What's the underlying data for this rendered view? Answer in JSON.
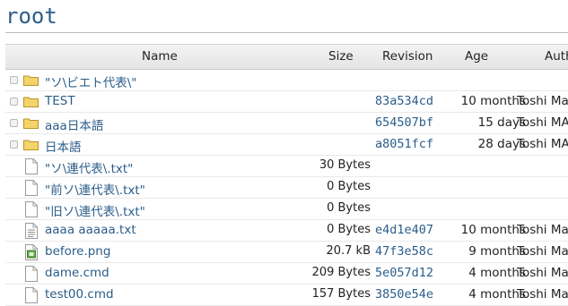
{
  "page": {
    "title": "root"
  },
  "columns": {
    "name": "Name",
    "size": "Size",
    "revision": "Revision",
    "age": "Age",
    "author": "Auth"
  },
  "rows": [
    {
      "type": "folder",
      "name": "\"ソ\\ビエト代表\\\"",
      "size": "",
      "revision": "",
      "age": "",
      "author": ""
    },
    {
      "type": "folder",
      "name": "TEST",
      "size": "",
      "revision": "83a534cd",
      "age": "10 months",
      "author": "Toshi Ma"
    },
    {
      "type": "folder",
      "name": "aaa日本語",
      "size": "",
      "revision": "654507bf",
      "age": "15 days",
      "author": "Toshi MA"
    },
    {
      "type": "folder",
      "name": "日本語",
      "size": "",
      "revision": "a8051fcf",
      "age": "28 days",
      "author": "Toshi MA"
    },
    {
      "type": "file",
      "name": "\"ソ\\連代表\\.txt\"",
      "size": "30 Bytes",
      "revision": "",
      "age": "",
      "author": ""
    },
    {
      "type": "file",
      "name": "\"前ソ\\連代表\\.txt\"",
      "size": "0 Bytes",
      "revision": "",
      "age": "",
      "author": ""
    },
    {
      "type": "file",
      "name": "\"旧ソ\\連代表\\.txt\"",
      "size": "0 Bytes",
      "revision": "",
      "age": "",
      "author": ""
    },
    {
      "type": "text",
      "name": "aaaa aaaaa.txt",
      "size": "0 Bytes",
      "revision": "e4d1e407",
      "age": "10 months",
      "author": "Toshi Ma"
    },
    {
      "type": "image",
      "name": "before.png",
      "size": "20.7 kB",
      "revision": "47f3e58c",
      "age": "9 months",
      "author": "Toshi Ma"
    },
    {
      "type": "file",
      "name": "dame.cmd",
      "size": "209 Bytes",
      "revision": "5e057d12",
      "age": "4 months",
      "author": "Toshi Ma"
    },
    {
      "type": "file",
      "name": "test00.cmd",
      "size": "157 Bytes",
      "revision": "3850e54e",
      "age": "4 months",
      "author": "Toshi Ma"
    }
  ]
}
